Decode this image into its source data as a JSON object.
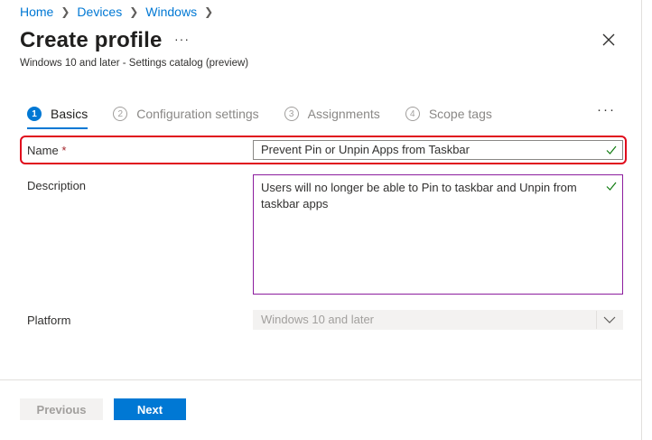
{
  "breadcrumb": {
    "items": [
      "Home",
      "Devices",
      "Windows"
    ]
  },
  "header": {
    "title": "Create profile",
    "more": "···",
    "subtitle": "Windows 10 and later - Settings catalog (preview)"
  },
  "wizard": {
    "steps": [
      {
        "num": "1",
        "label": "Basics"
      },
      {
        "num": "2",
        "label": "Configuration settings"
      },
      {
        "num": "3",
        "label": "Assignments"
      },
      {
        "num": "4",
        "label": "Scope tags"
      }
    ],
    "active_step": 0,
    "more": "···"
  },
  "form": {
    "name": {
      "label": "Name",
      "required_mark": "*",
      "value": "Prevent Pin or Unpin Apps from Taskbar"
    },
    "description": {
      "label": "Description",
      "value": "Users will no longer be able to Pin to taskbar and Unpin from taskbar apps"
    },
    "platform": {
      "label": "Platform",
      "value": "Windows 10 and later"
    }
  },
  "footer": {
    "previous_label": "Previous",
    "next_label": "Next"
  },
  "colors": {
    "accent": "#0078d4",
    "highlight": "#e00b1c",
    "check": "#107c10"
  }
}
